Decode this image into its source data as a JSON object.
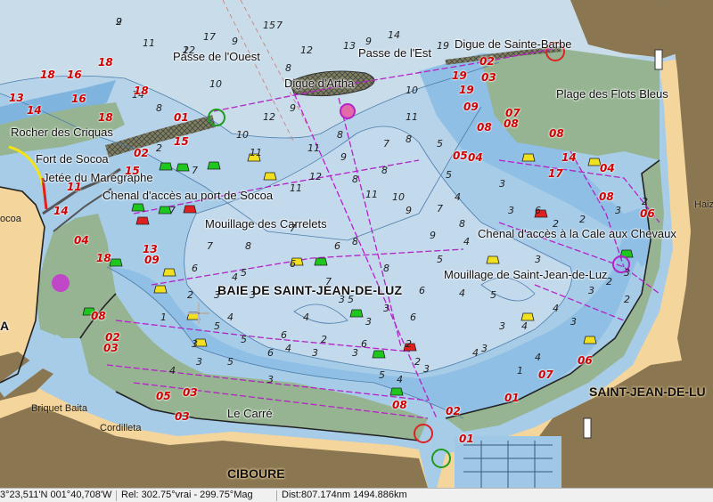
{
  "map": {
    "place_labels": [
      {
        "id": "passe-ouest",
        "text": "Passe de l'Ouest"
      },
      {
        "id": "passe-est",
        "text": "Passe de l'Est"
      },
      {
        "id": "digue-artha",
        "text": "Digue d'Artha"
      },
      {
        "id": "digue-sainte-barbe",
        "text": "Digue de Sainte-Barbe"
      },
      {
        "id": "plage-flots-bleus",
        "text": "Plage des Flots Bleus"
      },
      {
        "id": "rocher-criquas",
        "text": "Rocher des Criquas"
      },
      {
        "id": "fort-socoa",
        "text": "Fort de Socoa"
      },
      {
        "id": "jetee-maregraphe",
        "text": "Jetée du Marégraphe"
      },
      {
        "id": "chenal-socoa",
        "text": "Chenal d'accès au port de Socoa"
      },
      {
        "id": "mouillage-carrelets",
        "text": "Mouillage des Carrelets"
      },
      {
        "id": "chenal-cale",
        "text": "Chenal d'accès à la Cale aux Chevaux"
      },
      {
        "id": "mouillage-sjl",
        "text": "Mouillage de Saint-Jean-de-Luz"
      },
      {
        "id": "baie-sjl",
        "text": "BAIE DE SAINT-JEAN-DE-LUZ"
      },
      {
        "id": "le-carre",
        "text": "Le Carré"
      },
      {
        "id": "saint-jean-de-luz",
        "text": "SAINT-JEAN-DE-LU"
      },
      {
        "id": "ciboure",
        "text": "CIBOURE"
      },
      {
        "id": "briquet-baita",
        "text": "Briquet Baita"
      },
      {
        "id": "cordilleta",
        "text": "Cordilleta"
      },
      {
        "id": "socoa-edge",
        "text": "ocoa"
      },
      {
        "id": "haiz-edge",
        "text": "Haiz"
      },
      {
        "id": "a-edge",
        "text": "A"
      }
    ],
    "soundings": [
      "9",
      "12",
      "17",
      "15",
      "11",
      "14",
      "10",
      "12",
      "13",
      "14",
      "19",
      "10",
      "11",
      "8",
      "8",
      "9",
      "8",
      "7",
      "5",
      "9",
      "11",
      "9",
      "8",
      "8",
      "12",
      "11",
      "12",
      "11",
      "10",
      "7",
      "7",
      "9",
      "9",
      "8",
      "7",
      "7",
      "11",
      "10",
      "9",
      "8",
      "8",
      "7",
      "7",
      "8",
      "6",
      "6",
      "4",
      "5",
      "5",
      "6",
      "6",
      "5",
      "4",
      "8",
      "7",
      "6",
      "5",
      "5",
      "6",
      "3",
      "3",
      "3",
      "2",
      "3",
      "4",
      "3",
      "4",
      "2",
      "3",
      "4",
      "3",
      "5",
      "6",
      "6",
      "5",
      "4",
      "4",
      "3",
      "3",
      "2",
      "3",
      "2",
      "3",
      "3",
      "2",
      "3",
      "2",
      "3",
      "3",
      "4",
      "4",
      "6",
      "5",
      "4",
      "3",
      "2",
      "1",
      "2",
      "3",
      "4",
      "3",
      "4",
      "2",
      "5",
      "3",
      "2",
      "1",
      "4",
      "3",
      "2",
      "2"
    ],
    "drying_heights": [
      "13",
      "18",
      "16",
      "18",
      "14",
      "16",
      "18",
      "18",
      "15",
      "11",
      "14",
      "02",
      "15",
      "01",
      "04",
      "13",
      "18",
      "19",
      "09",
      "08",
      "08",
      "08",
      "07",
      "03",
      "02",
      "19",
      "05",
      "04",
      "14",
      "17",
      "04",
      "08",
      "06",
      "09",
      "03",
      "05",
      "03",
      "08",
      "02",
      "03",
      "06",
      "07",
      "01",
      "08",
      "01",
      "02"
    ]
  },
  "status": {
    "position": "3°23,511'N 001°40,708'W",
    "bearing": "Rel: 302.75°vrai - 299.75°Mag",
    "distance": "Dist:807.174nm  1494.886km"
  },
  "colors": {
    "land": "#f4d59c",
    "dark_land": "#8a7650",
    "intertidal": "#96b491",
    "deep_water": "#c8dcea",
    "shallow_water": "#a7cce8",
    "very_shallow": "#7fb4de",
    "magenta": "#b423c8",
    "buoy_green": "#1ec71e",
    "buoy_red": "#e02020",
    "buoy_yellow": "#f0e020"
  }
}
